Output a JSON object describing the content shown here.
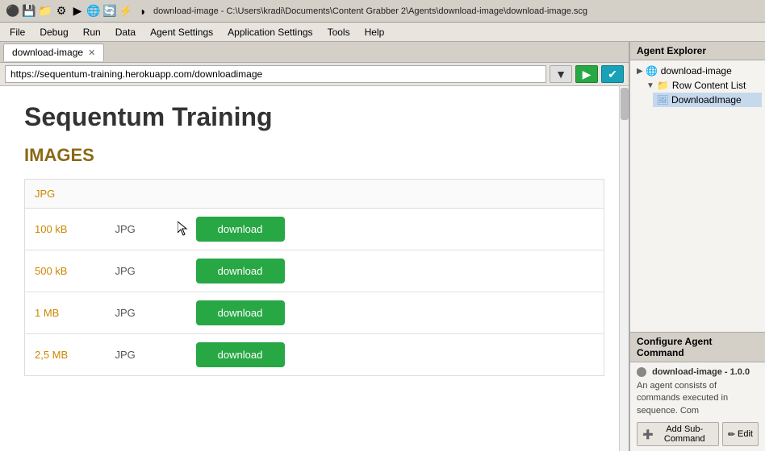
{
  "titlebar": {
    "title": "download-image - C:\\Users\\kradi\\Documents\\Content Grabber 2\\Agents\\download-image\\download-image.scg",
    "icons": [
      "⚫",
      "💾",
      "📁",
      "⚙",
      "▶",
      "🌐",
      "🔄",
      "⚡",
      "◑"
    ]
  },
  "menubar": {
    "items": [
      "File",
      "Debug",
      "Run",
      "Data",
      "Agent Settings",
      "Application Settings",
      "Tools",
      "Help"
    ]
  },
  "browser": {
    "tab_label": "download-image",
    "address": "https://sequentum-training.herokuapp.com/downloadimage",
    "go_btn": "▶",
    "check_btn": "✔"
  },
  "page": {
    "title": "Sequentum Training",
    "subtitle": "IMAGES",
    "header_col": "JPG",
    "rows": [
      {
        "size": "100 kB",
        "type": "JPG",
        "btn": "download"
      },
      {
        "size": "500 kB",
        "type": "JPG",
        "btn": "download"
      },
      {
        "size": "1 MB",
        "type": "JPG",
        "btn": "download"
      },
      {
        "size": "2,5 MB",
        "type": "JPG",
        "btn": "download"
      }
    ]
  },
  "agent_explorer": {
    "header": "Agent Explorer",
    "tree": {
      "root": "download-image",
      "child1": "Row Content List",
      "child2": "DownloadImage"
    }
  },
  "configure": {
    "header": "Configure Agent Command",
    "agent_label": "download-image - 1.0.0",
    "description": "An agent consists of commands executed in sequence. Com",
    "add_sub_btn": "Add Sub-Command",
    "edit_btn": "Edit"
  },
  "colors": {
    "download_btn": "#28a745",
    "size_color": "#cc8800",
    "subtitle_color": "#8b6914"
  }
}
